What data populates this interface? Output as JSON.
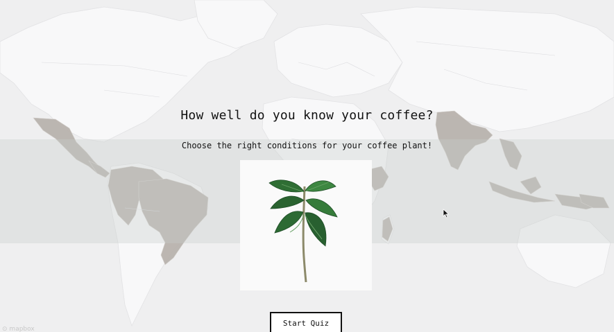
{
  "header": {
    "title": "How well do you know your coffee?",
    "subtitle": "Choose the right conditions for your coffee plant!"
  },
  "actions": {
    "start_label": "Start Quiz"
  },
  "map": {
    "attribution": "mapbox",
    "coffee_region_color": "#b8b2ad",
    "land_color": "#f7f7f8",
    "water_color": "#efeff0"
  },
  "icons": {
    "plant": "coffee-plant-illustration",
    "logo": "mapbox-logo-icon"
  }
}
